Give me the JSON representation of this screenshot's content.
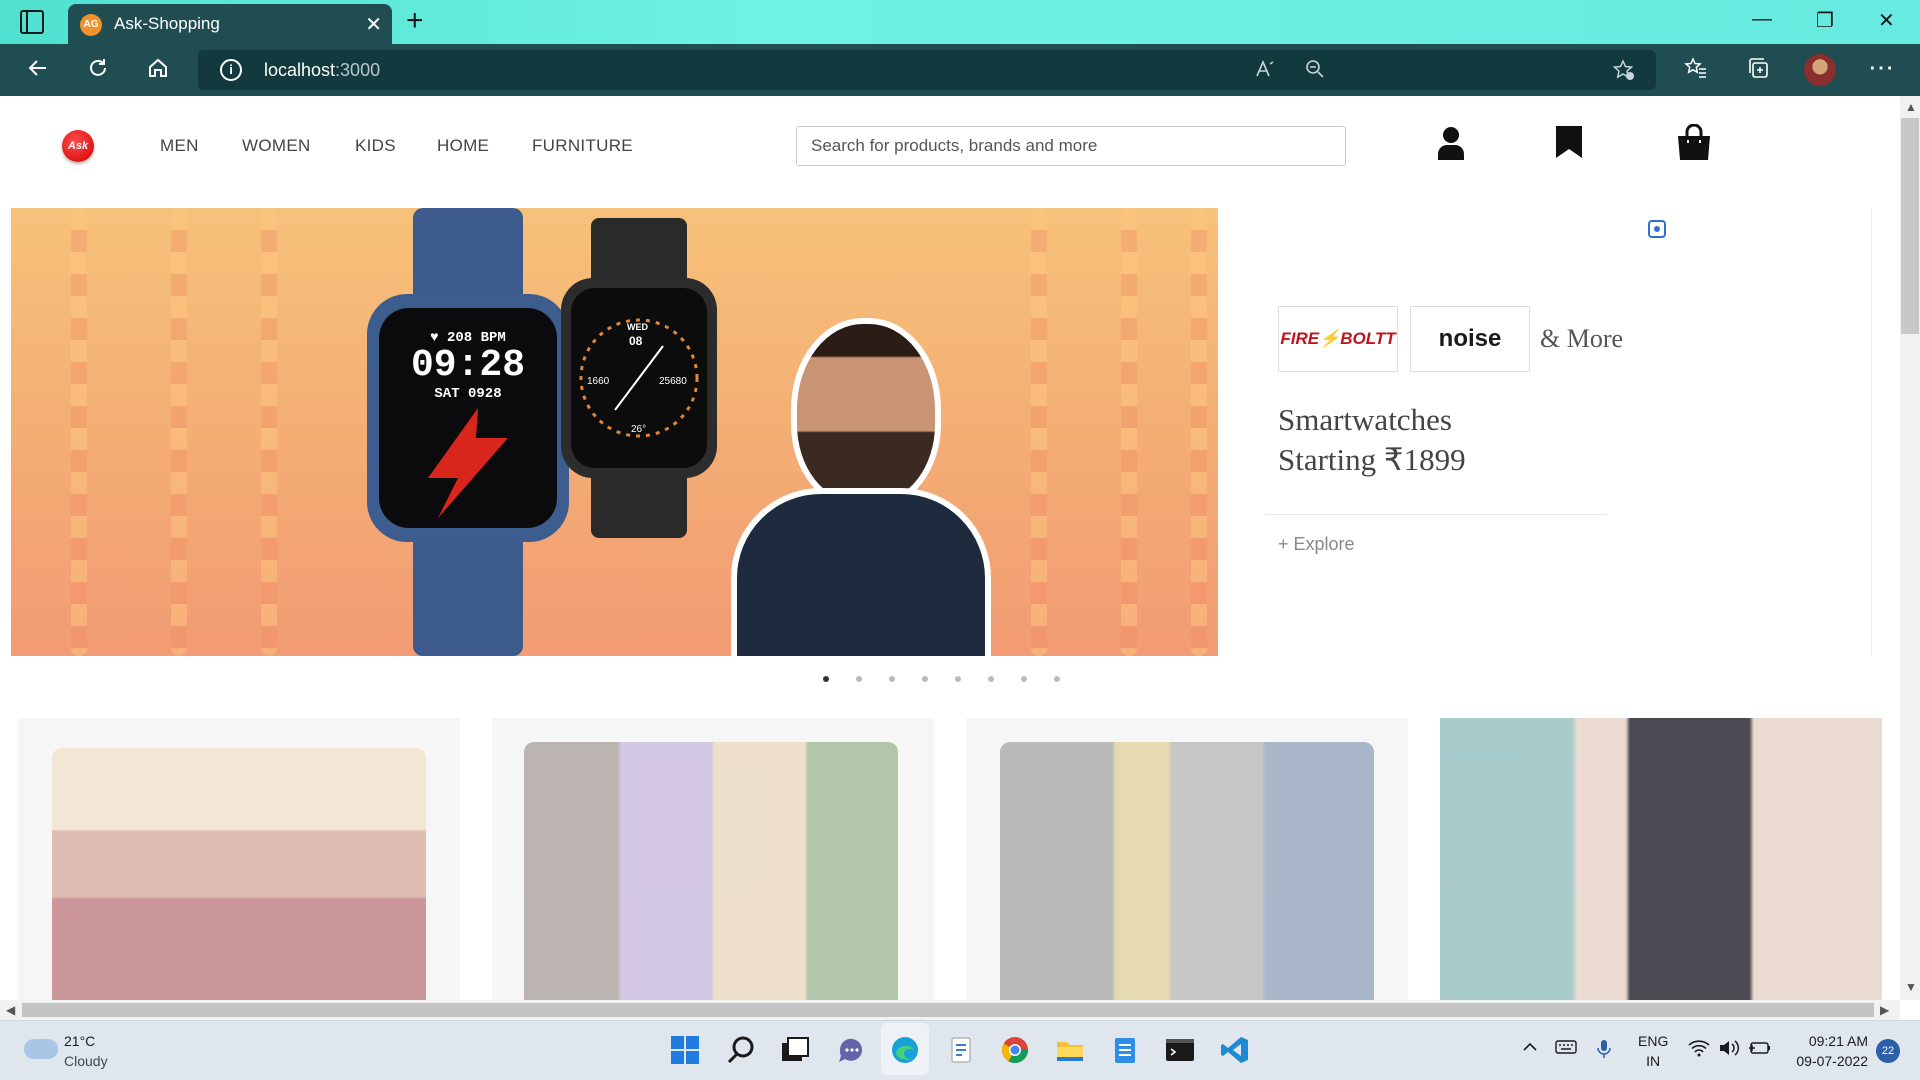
{
  "browser": {
    "tab": {
      "favicon_text": "AG",
      "title": "Ask-Shopping",
      "close": "✕"
    },
    "new_tab": "+",
    "window_controls": {
      "minimize": "—",
      "restore": "❐",
      "close": "✕"
    },
    "address": {
      "host": "localhost",
      "port": ":3000",
      "info_glyph": "i"
    },
    "toolbar_icons": [
      "back-icon",
      "refresh-icon",
      "home-icon",
      "read-aloud-icon",
      "zoom-out-icon",
      "add-favorite-icon",
      "favorites-icon",
      "collections-icon",
      "profile-avatar",
      "more-icon"
    ]
  },
  "site": {
    "logo_text": "Ask",
    "nav": [
      "MEN",
      "WOMEN",
      "KIDS",
      "HOME",
      "FURNITURE"
    ],
    "search_placeholder": "Search for products, brands and more",
    "header_icons": [
      "user-icon",
      "bookmark-icon",
      "shopping-bag-icon"
    ]
  },
  "hero": {
    "watch_blue": {
      "bpm": "♥ 208 BPM",
      "time": "09:28",
      "date": "SAT 0928"
    },
    "watch_black": {
      "day": "WED",
      "date": "08",
      "left": "1660",
      "right": "25680",
      "bottom": "26°"
    },
    "carousel_dots": 8,
    "active_dot": 0
  },
  "promo": {
    "brands": [
      "FIRE⚡BOLTT",
      "noise"
    ],
    "more": "& More",
    "title_line1": "Smartwatches",
    "title_line2": "Starting ₹1899",
    "cta": "+ Explore"
  },
  "colors": {
    "brand": "#d40000",
    "browser_chrome": "#1f4d52",
    "tab_strip": "#6ff2e2",
    "hero_top": "#f6c27a",
    "hero_bottom": "#f29b74"
  },
  "taskbar": {
    "weather_temp": "21°C",
    "weather_desc": "Cloudy",
    "apps": [
      "start-icon",
      "search-icon",
      "task-view-icon",
      "teams-chat-icon",
      "edge-icon",
      "files-icon",
      "chrome-icon",
      "explorer-icon",
      "notepad-icon",
      "terminal-icon",
      "vscode-icon"
    ],
    "lang_line1": "ENG",
    "lang_line2": "IN",
    "time": "09:21 AM",
    "date": "09-07-2022",
    "notifications": "22"
  }
}
